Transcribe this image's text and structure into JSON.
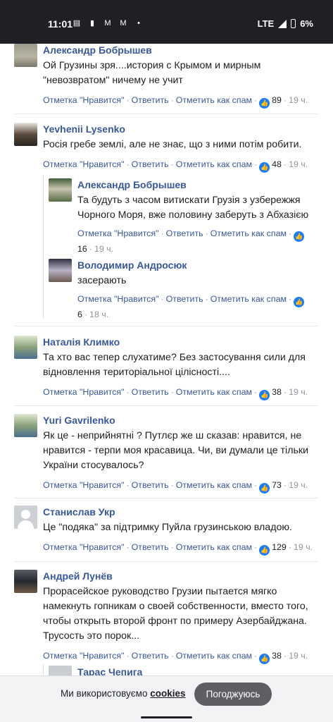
{
  "status_bar": {
    "time": "11:01",
    "network": "LTE",
    "battery": "6%"
  },
  "comments": [
    {
      "author": "Александр Бобрышев",
      "text": "Ой Грузины зря....история с Крымом и мирным \"невозвратом\" ничему не учит",
      "like_label": "Отметка \"Нравится\"",
      "reply_label": "Ответить",
      "spam_label": "Отметить как спам",
      "likes": "89",
      "time": "19 ч."
    },
    {
      "author": "Yevhenii Lysenko",
      "text": "Росія гребе землі, але не знає, що з ними потім робити.",
      "like_label": "Отметка \"Нравится\"",
      "reply_label": "Ответить",
      "spam_label": "Отметить как спам",
      "likes": "48",
      "time": "19 ч.",
      "replies": [
        {
          "author": "Александр Бобрышев",
          "text": "Та будуть з часом витискати Грузія з узбережжя Чорного Моря, вже половину заберуть з Абхазією",
          "like_label": "Отметка \"Нравится\"",
          "reply_label": "Ответить",
          "spam_label": "Отметить как спам",
          "likes": "16",
          "time": "19 ч."
        },
        {
          "author": "Володимир Андросюк",
          "text": "засерають",
          "like_label": "Отметка \"Нравится\"",
          "reply_label": "Ответить",
          "spam_label": "Отметить как спам",
          "likes": "6",
          "time": "18 ч."
        }
      ]
    },
    {
      "author": "Наталія Климко",
      "text": "Та хто вас тепер слухатиме? Без застосування сили для відновлення територіальної цілісності....",
      "like_label": "Отметка \"Нравится\"",
      "reply_label": "Ответить",
      "spam_label": "Отметить как спам",
      "likes": "38",
      "time": "19 ч."
    },
    {
      "author": "Yuri Gavrilenko",
      "text": "Як це - неприйнятні ? Путлєр же ш сказав: нравится, не нравится - терпи моя красавица. Чи, ви думали це тільки України стосувалось?",
      "like_label": "Отметка \"Нравится\"",
      "reply_label": "Ответить",
      "spam_label": "Отметить как спам",
      "likes": "73",
      "time": "19 ч."
    },
    {
      "author": "Станислав Укр",
      "text": "Це \"подяка\" за підтримку Пуйла грузинською владою.",
      "like_label": "Отметка \"Нравится\"",
      "reply_label": "Ответить",
      "spam_label": "Отметить как спам",
      "likes": "129",
      "time": "19 ч."
    },
    {
      "author": "Андрей Лунёв",
      "text": "Прорасейское руководство Грузии пытается мягко намекнуть гопникам о своей собственности, вместо того, чтобы открыть второй фронт по примеру Азербайджана. Трусость это порок...",
      "like_label": "Отметка \"Нравится\"",
      "reply_label": "Ответить",
      "spam_label": "Отметить как спам",
      "likes": "38",
      "time": "19 ч.",
      "replies": [
        {
          "author": "Тарас Чепига"
        }
      ]
    }
  ],
  "cookie_banner": {
    "text": "Ми використовуємо",
    "link": "cookies",
    "button": "Погоджуюсь"
  },
  "colors": {
    "link": "#385898",
    "like_badge": "#1b7cf4",
    "status_bar": "#1f2026"
  }
}
